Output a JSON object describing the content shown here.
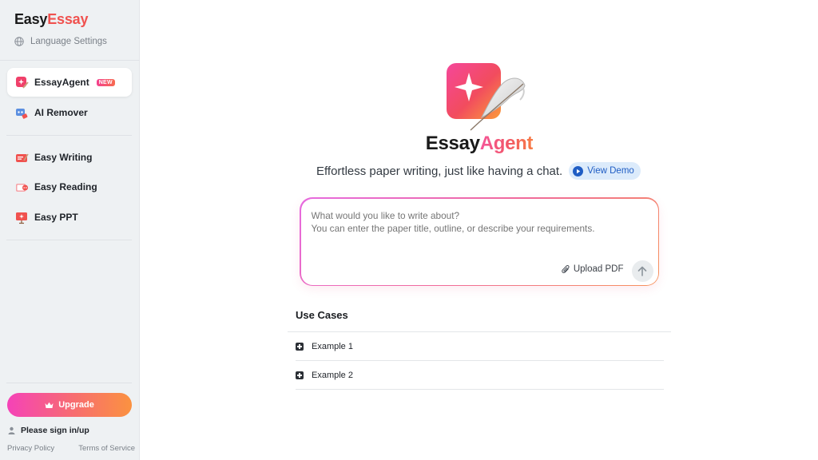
{
  "sidebar": {
    "logo": {
      "part1": "Easy",
      "part2": "Essay"
    },
    "language_label": "Language Settings",
    "items": [
      {
        "label": "EssayAgent",
        "badge": "NEW",
        "icon": "essay-agent-icon",
        "active": true
      },
      {
        "label": "AI Remover",
        "icon": "ai-remover-icon"
      },
      {
        "label": "Easy Writing",
        "icon": "easy-writing-icon"
      },
      {
        "label": "Easy Reading",
        "icon": "easy-reading-icon"
      },
      {
        "label": "Easy PPT",
        "icon": "easy-ppt-icon"
      }
    ],
    "upgrade_label": "Upgrade",
    "signin_label": "Please sign in/up",
    "privacy_label": "Privacy Policy",
    "terms_label": "Terms of Service"
  },
  "main": {
    "title_part1": "Essay",
    "title_part2": "Agent",
    "subtitle": "Effortless paper writing, just like having a chat.",
    "view_demo_label": "View Demo",
    "prompt_placeholder": "What would you like to write about?\nYou can enter the paper title, outline, or describe your requirements.",
    "upload_label": "Upload PDF",
    "use_cases_title": "Use Cases",
    "use_cases": [
      {
        "label": "Example 1"
      },
      {
        "label": "Example 2"
      }
    ]
  },
  "colors": {
    "brand_red": "#f0524f",
    "gradient_pink": "#f542b8",
    "gradient_orange": "#fb9240",
    "demo_blue": "#1f5dc4"
  }
}
